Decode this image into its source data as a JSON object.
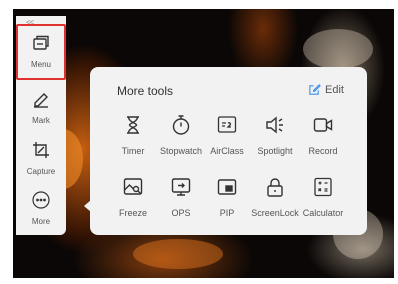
{
  "sidebar": {
    "collapse_glyph": "<<",
    "tools": [
      {
        "label": "Menu",
        "icon": "menu-window-icon",
        "selected": true
      },
      {
        "label": "Mark",
        "icon": "pen-icon",
        "selected": false
      },
      {
        "label": "Capture",
        "icon": "crop-icon",
        "selected": false
      },
      {
        "label": "More",
        "icon": "more-dots-icon",
        "selected": false
      }
    ]
  },
  "panel": {
    "title": "More tools",
    "edit_label": "Edit",
    "accent": "#3b8fe6",
    "items": [
      {
        "label": "Timer",
        "icon": "hourglass-icon"
      },
      {
        "label": "Stopwatch",
        "icon": "stopwatch-icon"
      },
      {
        "label": "AirClass",
        "icon": "airclass-icon"
      },
      {
        "label": "Spotlight",
        "icon": "spotlight-icon"
      },
      {
        "label": "Record",
        "icon": "video-record-icon"
      },
      {
        "label": "Freeze",
        "icon": "freeze-icon"
      },
      {
        "label": "OPS",
        "icon": "ops-icon"
      },
      {
        "label": "PIP",
        "icon": "pip-icon"
      },
      {
        "label": "ScreenLock",
        "icon": "lock-icon"
      },
      {
        "label": "Calculator",
        "icon": "calculator-icon"
      }
    ]
  },
  "colors": {
    "selection_border": "#e03131",
    "panel_bg": "#f2f2f2",
    "icon_stroke": "#333333"
  }
}
